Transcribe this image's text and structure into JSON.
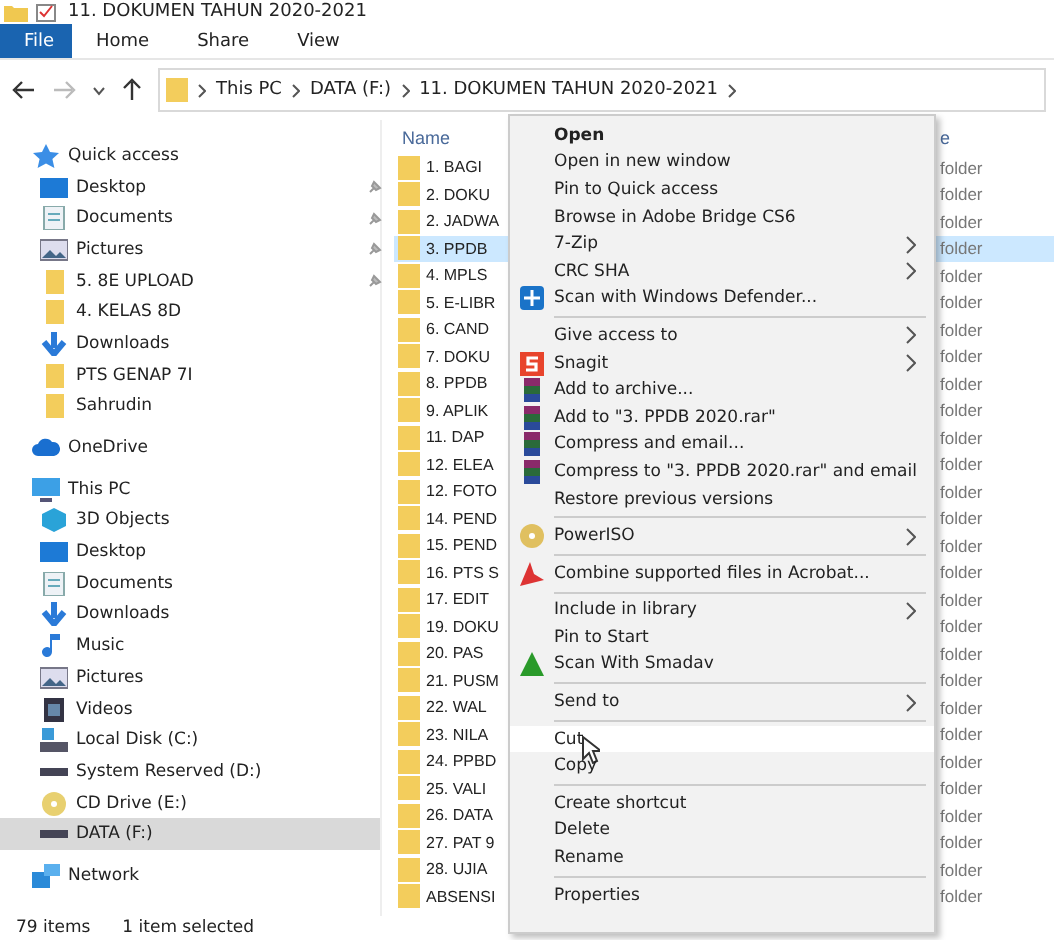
{
  "window": {
    "title": "11. DOKUMEN TAHUN 2020-2021"
  },
  "ribbon_tabs": [
    {
      "label": "File",
      "selected": true
    },
    {
      "label": "Home",
      "selected": false
    },
    {
      "label": "Share",
      "selected": false
    },
    {
      "label": "View",
      "selected": false
    }
  ],
  "address_bar": {
    "path": [
      "This PC",
      "DATA (F:)",
      "11. DOKUMEN TAHUN 2020-2021"
    ]
  },
  "sidebar": {
    "items": [
      {
        "label": "Quick access",
        "kind": "star",
        "selected": false,
        "children": [
          {
            "label": "Desktop",
            "kind": "desktop",
            "pinned": true,
            "selected": false
          },
          {
            "label": "Documents",
            "kind": "document",
            "pinned": true,
            "selected": false
          },
          {
            "label": "Pictures",
            "kind": "picture",
            "pinned": true,
            "selected": false
          },
          {
            "label": "5. 8E UPLOAD",
            "kind": "folder",
            "pinned": true,
            "selected": false
          },
          {
            "label": "4. KELAS 8D",
            "kind": "folder",
            "pinned": false,
            "selected": false
          },
          {
            "label": "Downloads",
            "kind": "download",
            "pinned": false,
            "selected": false
          },
          {
            "label": "PTS GENAP 7I",
            "kind": "folder",
            "pinned": false,
            "selected": false
          },
          {
            "label": "Sahrudin",
            "kind": "folder",
            "pinned": false,
            "selected": false
          }
        ]
      },
      {
        "label": "OneDrive",
        "kind": "cloud",
        "selected": false
      },
      {
        "label": "This PC",
        "kind": "pc",
        "selected": false,
        "children": [
          {
            "label": "3D Objects",
            "kind": "cube",
            "selected": false
          },
          {
            "label": "Desktop",
            "kind": "desktop",
            "selected": false
          },
          {
            "label": "Documents",
            "kind": "document",
            "selected": false
          },
          {
            "label": "Downloads",
            "kind": "download",
            "selected": false
          },
          {
            "label": "Music",
            "kind": "music",
            "selected": false
          },
          {
            "label": "Pictures",
            "kind": "picture",
            "selected": false
          },
          {
            "label": "Videos",
            "kind": "video",
            "selected": false
          },
          {
            "label": "Local Disk (C:)",
            "kind": "system-drive",
            "selected": false
          },
          {
            "label": "System Reserved (D:)",
            "kind": "drive",
            "selected": false
          },
          {
            "label": "CD Drive (E:)",
            "kind": "cd",
            "selected": false
          },
          {
            "label": "DATA (F:)",
            "kind": "drive",
            "selected": true
          }
        ]
      },
      {
        "label": "Network",
        "kind": "network",
        "selected": false
      }
    ]
  },
  "file_list": {
    "columns": [
      "Name",
      "e"
    ],
    "rows": [
      {
        "name": "1. BAGI",
        "type": "folder",
        "selected": false
      },
      {
        "name": "2. DOKU",
        "type": "folder",
        "selected": false
      },
      {
        "name": "2. JADWA",
        "type": "folder",
        "selected": false
      },
      {
        "name": "3. PPDB",
        "type": "folder",
        "selected": true
      },
      {
        "name": "4. MPLS",
        "type": "folder",
        "selected": false
      },
      {
        "name": "5. E-LIBR",
        "type": "folder",
        "selected": false
      },
      {
        "name": "6. CAND",
        "type": "folder",
        "selected": false
      },
      {
        "name": "7. DOKU",
        "type": "folder",
        "selected": false
      },
      {
        "name": "8. PPDB",
        "type": "folder",
        "selected": false
      },
      {
        "name": "9. APLIK",
        "type": "folder",
        "selected": false
      },
      {
        "name": "11. DAP",
        "type": "folder",
        "selected": false
      },
      {
        "name": "12. ELEA",
        "type": "folder",
        "selected": false
      },
      {
        "name": "12. FOTO",
        "type": "folder",
        "selected": false
      },
      {
        "name": "14. PEND",
        "type": "folder",
        "selected": false
      },
      {
        "name": "15. PEND",
        "type": "folder",
        "selected": false
      },
      {
        "name": "16. PTS S",
        "type": "folder",
        "selected": false
      },
      {
        "name": "17. EDIT",
        "type": "folder",
        "selected": false
      },
      {
        "name": "19. DOKU",
        "type": "folder",
        "selected": false
      },
      {
        "name": "20. PAS",
        "type": "folder",
        "selected": false
      },
      {
        "name": "21. PUSM",
        "type": "folder",
        "selected": false
      },
      {
        "name": "22. WAL",
        "type": "folder",
        "selected": false
      },
      {
        "name": "23. NILA",
        "type": "folder",
        "selected": false
      },
      {
        "name": "24. PPBD",
        "type": "folder",
        "selected": false
      },
      {
        "name": "25. VALI",
        "type": "folder",
        "selected": false
      },
      {
        "name": "26. DATA",
        "type": "folder",
        "selected": false
      },
      {
        "name": "27. PAT 9",
        "type": "folder",
        "selected": false
      },
      {
        "name": "28. UJIA",
        "type": "folder",
        "selected": false
      },
      {
        "name": "ABSENSI",
        "type": "folder",
        "selected": false
      }
    ]
  },
  "context_menu": {
    "items": [
      {
        "kind": "default",
        "label": "Open",
        "submenu": false,
        "selected": false
      },
      {
        "kind": "item",
        "label": "Open in new window",
        "submenu": false,
        "selected": false
      },
      {
        "kind": "item",
        "label": "Pin to Quick access",
        "submenu": false,
        "selected": false
      },
      {
        "kind": "item",
        "label": "Browse in Adobe Bridge CS6",
        "submenu": false,
        "selected": false
      },
      {
        "kind": "item",
        "label": "7-Zip",
        "submenu": true,
        "selected": false
      },
      {
        "kind": "item",
        "label": "CRC SHA",
        "submenu": true,
        "selected": false
      },
      {
        "kind": "shield",
        "label": "Scan with Windows Defender...",
        "submenu": false,
        "selected": false
      },
      {
        "kind": "separator"
      },
      {
        "kind": "item",
        "label": "Give access to",
        "submenu": true,
        "selected": false
      },
      {
        "kind": "snagit",
        "label": "Snagit",
        "submenu": true,
        "selected": false
      },
      {
        "kind": "archive",
        "label": "Add to archive...",
        "submenu": false,
        "selected": false
      },
      {
        "kind": "archive",
        "label": "Add to \"3. PPDB 2020.rar\"",
        "submenu": false,
        "selected": false
      },
      {
        "kind": "archive",
        "label": "Compress and email...",
        "submenu": false,
        "selected": false
      },
      {
        "kind": "archive",
        "label": "Compress to \"3. PPDB 2020.rar\" and email",
        "submenu": false,
        "selected": false
      },
      {
        "kind": "item",
        "label": "Restore previous versions",
        "submenu": false,
        "selected": false
      },
      {
        "kind": "separator"
      },
      {
        "kind": "disc",
        "label": "PowerISO",
        "submenu": true,
        "selected": false
      },
      {
        "kind": "separator"
      },
      {
        "kind": "acrobat",
        "label": "Combine supported files in Acrobat...",
        "submenu": false,
        "selected": false
      },
      {
        "kind": "separator"
      },
      {
        "kind": "item",
        "label": "Include in library",
        "submenu": true,
        "selected": false
      },
      {
        "kind": "item",
        "label": "Pin to Start",
        "submenu": false,
        "selected": false
      },
      {
        "kind": "triangle",
        "label": "Scan With Smadav",
        "submenu": false,
        "selected": false
      },
      {
        "kind": "separator"
      },
      {
        "kind": "item",
        "label": "Send to",
        "submenu": true,
        "selected": false
      },
      {
        "kind": "separator"
      },
      {
        "kind": "item",
        "label": "Cut",
        "submenu": false,
        "selected": true
      },
      {
        "kind": "item",
        "label": "Copy",
        "submenu": false,
        "selected": false
      },
      {
        "kind": "separator"
      },
      {
        "kind": "item",
        "label": "Create shortcut",
        "submenu": false,
        "selected": false
      },
      {
        "kind": "item",
        "label": "Delete",
        "submenu": false,
        "selected": false
      },
      {
        "kind": "item",
        "label": "Rename",
        "submenu": false,
        "selected": false
      },
      {
        "kind": "separator"
      },
      {
        "kind": "item",
        "label": "Properties",
        "submenu": false,
        "selected": false
      }
    ]
  },
  "status_bar": {
    "item_count": "79 items",
    "selection": "1 item selected"
  }
}
